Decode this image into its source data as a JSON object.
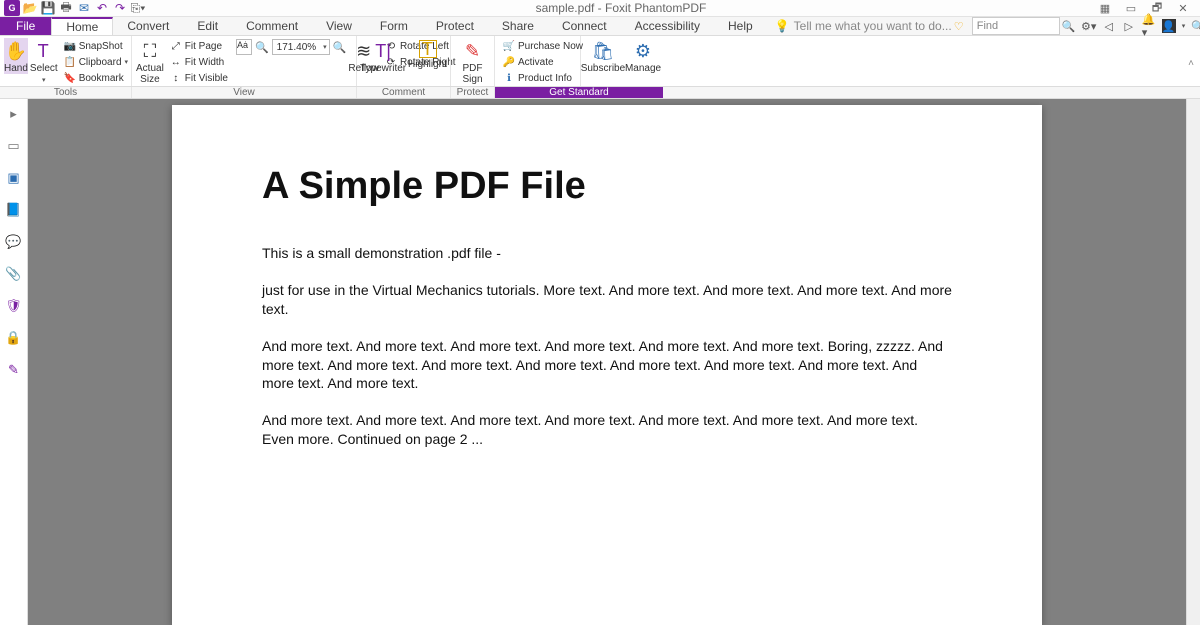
{
  "title": "sample.pdf - Foxit PhantomPDF",
  "qat": {},
  "tabs": {
    "file": "File",
    "items": [
      "Home",
      "Convert",
      "Edit",
      "Comment",
      "View",
      "Form",
      "Protect",
      "Share",
      "Connect",
      "Accessibility",
      "Help"
    ],
    "active": "Home",
    "tellme": "Tell me what you want to do..."
  },
  "find": {
    "placeholder": "Find"
  },
  "ribbon": {
    "tools": {
      "hand": "Hand",
      "select": "Select",
      "snapshot": "SnapShot",
      "clipboard": "Clipboard",
      "bookmark": "Bookmark",
      "label": "Tools"
    },
    "view": {
      "actual_size": "Actual\nSize",
      "fit_page": "Fit Page",
      "fit_width": "Fit Width",
      "fit_visible": "Fit Visible",
      "zoom": "171.40%",
      "reflow": "Reflow",
      "rotate_left": "Rotate Left",
      "rotate_right": "Rotate Right",
      "label": "View"
    },
    "comment": {
      "typewriter": "Typewriter",
      "highlight": "Highlight",
      "label": "Comment"
    },
    "protect": {
      "pdf_sign": "PDF\nSign",
      "label": "Protect"
    },
    "links": {
      "purchase": "Purchase Now",
      "activate": "Activate",
      "product_info": "Product Info"
    },
    "manage": {
      "subscribe": "Subscribe",
      "manage": "Manage"
    },
    "banner": "Get Standard"
  },
  "document": {
    "heading": "A Simple PDF File",
    "p1": "This is a small demonstration .pdf file -",
    "p2": "just for use in the Virtual Mechanics tutorials. More text. And more text. And more text. And more text. And more text.",
    "p3": "And more text. And more text. And more text. And more text. And more text. And more text. Boring, zzzzz. And more text. And more text. And more text. And more text. And more text. And more text. And more text. And more text. And more text.",
    "p4": "And more text. And more text. And more text. And more text. And more text. And more text. And more text. Even more. Continued on page 2 ..."
  }
}
